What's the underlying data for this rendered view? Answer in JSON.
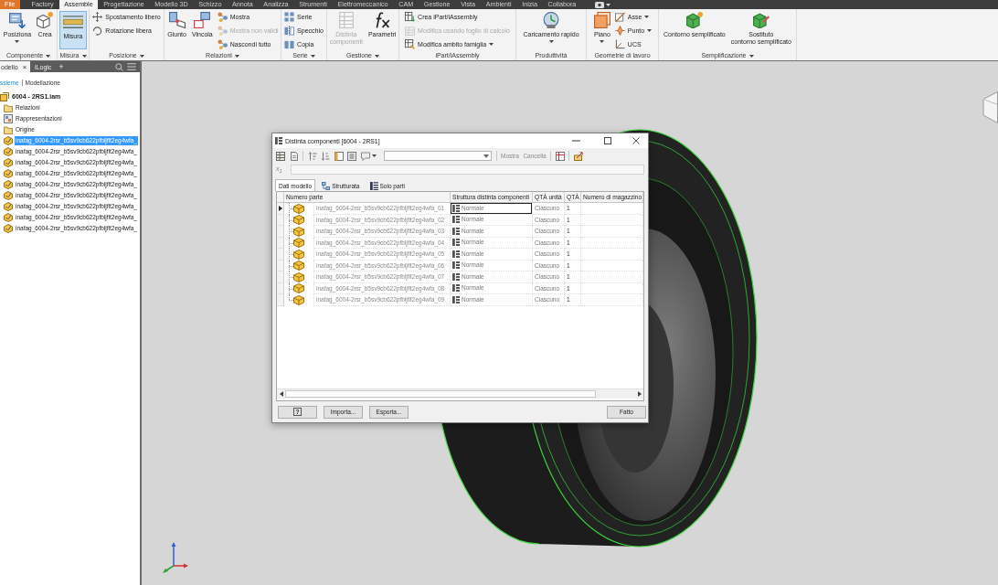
{
  "menu_bar": {
    "tabs": [
      {
        "label": "File",
        "kind": "file",
        "selected": false
      },
      {
        "label": "Factory",
        "kind": "tab",
        "selected": false
      },
      {
        "label": "Assemble",
        "kind": "tab",
        "selected": true
      },
      {
        "label": "Progettazione",
        "kind": "tab",
        "selected": false
      },
      {
        "label": "Modello 3D",
        "kind": "tab",
        "selected": false
      },
      {
        "label": "Schizzo",
        "kind": "tab",
        "selected": false
      },
      {
        "label": "Annota",
        "kind": "tab",
        "selected": false
      },
      {
        "label": "Analizza",
        "kind": "tab",
        "selected": false
      },
      {
        "label": "Strumenti",
        "kind": "tab",
        "selected": false
      },
      {
        "label": "Elettromeccanico",
        "kind": "tab",
        "selected": false
      },
      {
        "label": "CAM",
        "kind": "tab",
        "selected": false
      },
      {
        "label": "Gestione",
        "kind": "tab",
        "selected": false
      },
      {
        "label": "Vista",
        "kind": "tab",
        "selected": false
      },
      {
        "label": "Ambienti",
        "kind": "tab",
        "selected": false
      },
      {
        "label": "Inizia",
        "kind": "tab",
        "selected": false
      },
      {
        "label": "Collabora",
        "kind": "tab",
        "selected": false
      }
    ]
  },
  "ribbon": {
    "panels": [
      {
        "label": "Componente",
        "dropdown": true,
        "buttons": [
          {
            "kind": "large",
            "label": "Posiziona",
            "dropdown": true
          },
          {
            "kind": "large",
            "label": "Crea"
          }
        ]
      },
      {
        "label": "Misura",
        "dropdown": true,
        "buttons": [
          {
            "kind": "large",
            "label": "Misura",
            "on": true
          }
        ]
      },
      {
        "label": "Posizione",
        "dropdown": true,
        "buttons": [
          {
            "kind": "small",
            "label": "Spostamento libero"
          },
          {
            "kind": "small",
            "label": "Rotazione libera"
          }
        ]
      },
      {
        "label": "Relazioni",
        "dropdown": true,
        "buttons": [
          {
            "kind": "large",
            "label": "Giunto",
            "disabled": false
          },
          {
            "kind": "large",
            "label": "Vincola",
            "disabled": false
          },
          {
            "kind": "small",
            "label": "Mostra",
            "disabled": false
          },
          {
            "kind": "small",
            "label": "Mostra non validi",
            "disabled": true
          },
          {
            "kind": "small",
            "label": "Nascondi tutto",
            "disabled": false
          }
        ]
      },
      {
        "label": "Serie",
        "dropdown": true,
        "buttons": [
          {
            "kind": "small",
            "label": "Serie"
          },
          {
            "kind": "small",
            "label": "Specchio"
          },
          {
            "kind": "small",
            "label": "Copia"
          }
        ]
      },
      {
        "label": "Gestione",
        "dropdown": true,
        "buttons": [
          {
            "kind": "large",
            "label": "Distinta\ncomponenti",
            "disabled": true
          },
          {
            "kind": "large",
            "label": "Parametri",
            "disabled": false
          }
        ]
      },
      {
        "label": "iPart/iAssembly",
        "buttons": [
          {
            "kind": "small",
            "label": "Crea iPart/iAssembly",
            "disabled": false
          },
          {
            "kind": "small",
            "label": "Modifica usando foglio di calcolo",
            "disabled": true
          },
          {
            "kind": "small",
            "label": "Modifica ambito famiglia",
            "disabled": false,
            "dropdown": true
          }
        ]
      },
      {
        "label": "Produttività",
        "buttons": [
          {
            "kind": "large",
            "label": "Caricamento rapido",
            "dropdown": true
          }
        ]
      },
      {
        "label": "Geometrie di lavoro",
        "buttons": [
          {
            "kind": "large",
            "label": "Piano",
            "dropdown": true
          },
          {
            "kind": "small",
            "label": "Asse",
            "dropdown": true
          },
          {
            "kind": "small",
            "label": "Punto",
            "dropdown": true
          },
          {
            "kind": "small",
            "label": "UCS"
          }
        ]
      },
      {
        "label": "Semplificazione",
        "dropdown": true,
        "buttons": [
          {
            "kind": "large",
            "label": "Contorno semplificato"
          },
          {
            "kind": "large",
            "label": "Sostituto\ncontorno semplificato"
          }
        ]
      }
    ]
  },
  "browser": {
    "tabs": [
      {
        "label": "odello",
        "selected": true,
        "close": "×"
      },
      {
        "label": "iLogic",
        "selected": false
      }
    ],
    "add_tab": "+",
    "modes": [
      {
        "label": "ssieme",
        "selected": true
      },
      {
        "label": "Modellazione",
        "selected": false
      }
    ],
    "tree": [
      {
        "label": "6004 - 2RS1.iam",
        "kind": "assembly",
        "selected": false,
        "children": [
          {
            "label": "Relazioni",
            "kind": "folder",
            "selected": false
          },
          {
            "label": "Rappresentazioni",
            "kind": "representations",
            "selected": false
          },
          {
            "label": "Origine",
            "kind": "folder",
            "selected": false
          },
          {
            "label": "inafag_6004-2rsr_b5sv9cb622pfbljflt2eg4wfa_",
            "kind": "component",
            "selected": true
          },
          {
            "label": "inafag_6004-2rsr_b5sv9cb622pfbljflt2eg4wfa_",
            "kind": "component",
            "selected": false
          },
          {
            "label": "inafag_6004-2rsr_b5sv9cb622pfbljflt2eg4wfa_",
            "kind": "component",
            "selected": false
          },
          {
            "label": "inafag_6004-2rsr_b5sv9cb622pfbljflt2eg4wfa_",
            "kind": "component",
            "selected": false
          },
          {
            "label": "inafag_6004-2rsr_b5sv9cb622pfbljflt2eg4wfa_",
            "kind": "component",
            "selected": false
          },
          {
            "label": "inafag_6004-2rsr_b5sv9cb622pfbljflt2eg4wfa_",
            "kind": "component",
            "selected": false
          },
          {
            "label": "inafag_6004-2rsr_b5sv9cb622pfbljflt2eg4wfa_",
            "kind": "component",
            "selected": false
          },
          {
            "label": "inafag_6004-2rsr_b5sv9cb622pfbljflt2eg4wfa_",
            "kind": "component",
            "selected": false
          },
          {
            "label": "inafag_6004-2rsr_b5sv9cb622pfbljflt2eg4wfa_",
            "kind": "component",
            "selected": false
          }
        ]
      }
    ]
  },
  "bom_dialog": {
    "title": "Distinta componenti [6004 - 2RS1]",
    "actions": [
      {
        "label": "Mostra",
        "disabled": true
      },
      {
        "label": "Cancella",
        "disabled": true
      }
    ],
    "formula_symbol": "x$_{1}$",
    "tabs": [
      {
        "label": "Dati modello",
        "kind": "plain",
        "selected": true
      },
      {
        "label": "Strutturata",
        "kind": "structured",
        "selected": false
      },
      {
        "label": "Solo parti",
        "kind": "parts_only",
        "selected": false
      }
    ],
    "table": {
      "columns": [
        "Numero parte",
        "Struttura distinta componenti",
        "QTÀ unità",
        "QTÀ",
        "Numero di magazzino"
      ],
      "rows": [
        {
          "selected": true,
          "part_number": "inafag_6004-2rsr_b5sv9cb622pfbljflt2eg4wfa_01",
          "bom_structure": "Normale",
          "unit_qty": "Ciascuno",
          "qty": "1"
        },
        {
          "selected": false,
          "part_number": "inafag_6004-2rsr_b5sv9cb622pfbljflt2eg4wfa_02",
          "bom_structure": "Normale",
          "unit_qty": "Ciascuno",
          "qty": "1"
        },
        {
          "selected": false,
          "part_number": "inafag_6004-2rsr_b5sv9cb622pfbljflt2eg4wfa_03",
          "bom_structure": "Normale",
          "unit_qty": "Ciascuno",
          "qty": "1"
        },
        {
          "selected": false,
          "part_number": "inafag_6004-2rsr_b5sv9cb622pfbljflt2eg4wfa_04",
          "bom_structure": "Normale",
          "unit_qty": "Ciascuno",
          "qty": "1"
        },
        {
          "selected": false,
          "part_number": "inafag_6004-2rsr_b5sv9cb622pfbljflt2eg4wfa_05",
          "bom_structure": "Normale",
          "unit_qty": "Ciascuno",
          "qty": "1"
        },
        {
          "selected": false,
          "part_number": "inafag_6004-2rsr_b5sv9cb622pfbljflt2eg4wfa_06",
          "bom_structure": "Normale",
          "unit_qty": "Ciascuno",
          "qty": "1"
        },
        {
          "selected": false,
          "part_number": "inafag_6004-2rsr_b5sv9cb622pfbljflt2eg4wfa_07",
          "bom_structure": "Normale",
          "unit_qty": "Ciascuno",
          "qty": "1"
        },
        {
          "selected": false,
          "part_number": "inafag_6004-2rsr_b5sv9cb622pfbljflt2eg4wfa_08",
          "bom_structure": "Normale",
          "unit_qty": "Ciascuno",
          "qty": "1"
        },
        {
          "selected": false,
          "part_number": "inafag_6004-2rsr_b5sv9cb622pfbljflt2eg4wfa_09",
          "bom_structure": "Normale",
          "unit_qty": "Ciascuno",
          "qty": "1"
        }
      ]
    },
    "help_button": "?",
    "buttons": [
      "Importa...",
      "Esporta..."
    ],
    "done_button": "Fatto"
  }
}
